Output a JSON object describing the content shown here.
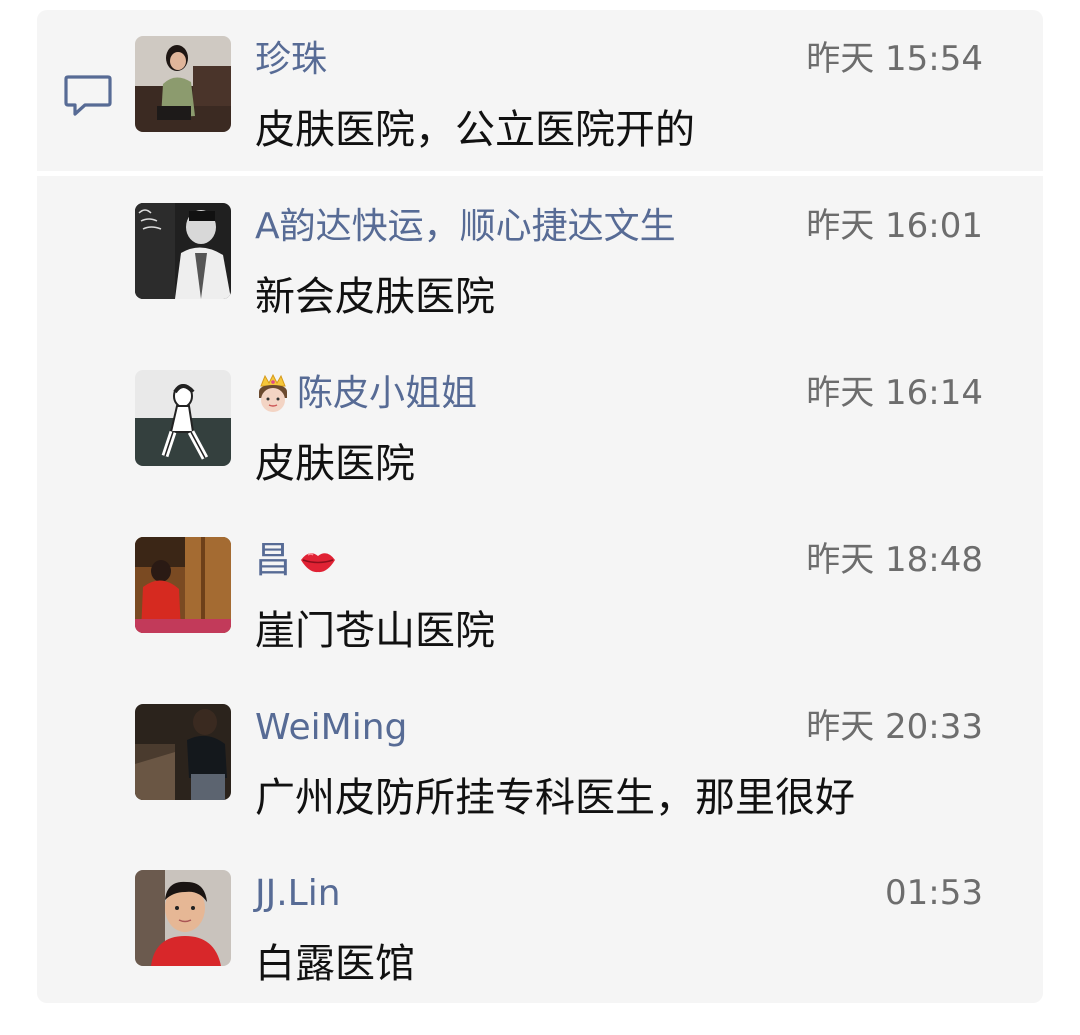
{
  "comments": [
    {
      "name": "珍珠",
      "time": "昨天 15:54",
      "text": "皮肤医院，公立医院开的",
      "avatar_icon": "avatar-woman-sofa"
    },
    {
      "name": "A韵达快运，顺心捷达文生",
      "time": "昨天 16:01",
      "text": "新会皮肤医院",
      "avatar_icon": "avatar-man-bw-new-collection"
    },
    {
      "name": "陈皮小姐姐",
      "time": "昨天 16:14",
      "text": "皮肤医院",
      "avatar_icon": "avatar-sketch-girl",
      "name_prefix_icon": "princess-emoji"
    },
    {
      "name": "昌",
      "time": "昨天 18:48",
      "text": "崖门苍山医院",
      "avatar_icon": "avatar-red-wood",
      "name_suffix_icon": "lips-emoji"
    },
    {
      "name": "WeiMing",
      "time": "昨天 20:33",
      "text": "广州皮防所挂专科医生，那里很好",
      "avatar_icon": "avatar-dark-photo"
    },
    {
      "name": "JJ.Lin",
      "time": "01:53",
      "text": "白露医馆",
      "avatar_icon": "avatar-young-man"
    }
  ],
  "colors": {
    "name": "#576b95",
    "panel_bg": "#f5f5f5",
    "time": "#6d6d6d",
    "text": "#111111"
  },
  "icons": {
    "section": "comment-bubble-icon"
  }
}
